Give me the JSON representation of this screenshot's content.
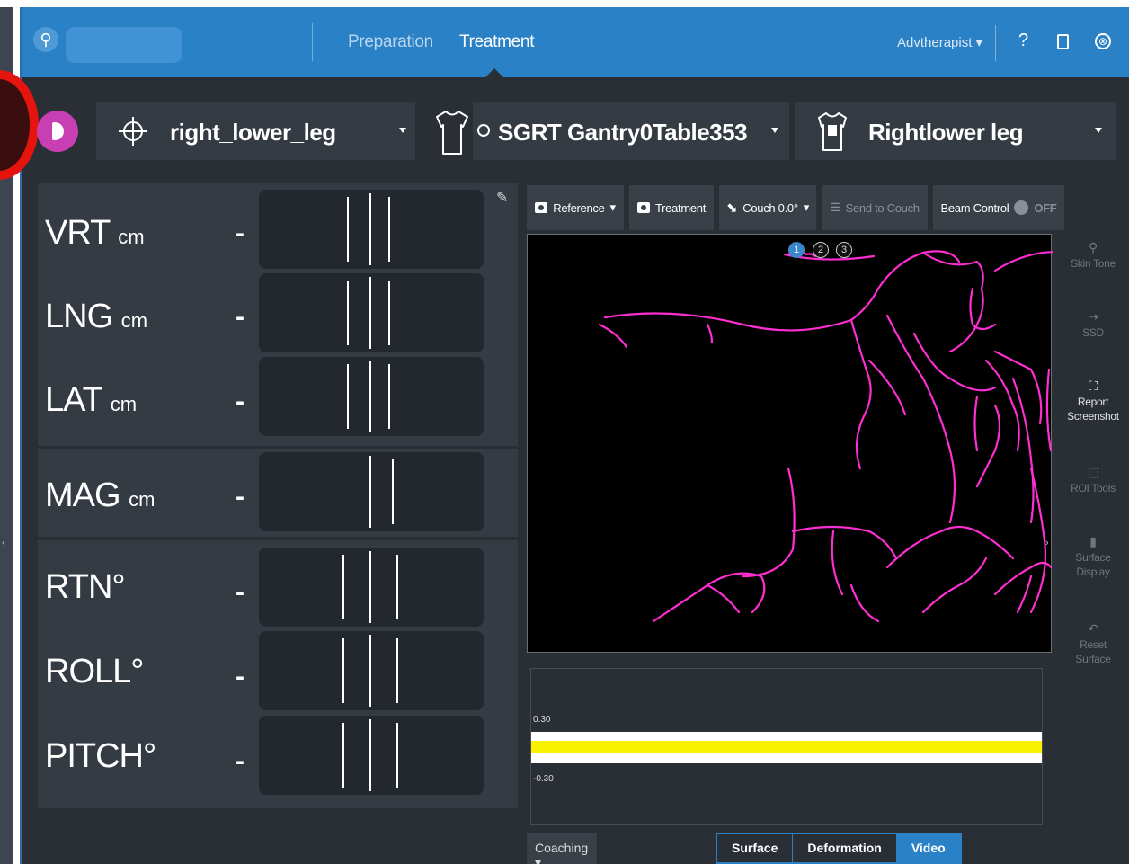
{
  "header": {
    "tabs": [
      "Preparation",
      "Treatment"
    ],
    "active_tab": "Treatment",
    "user_role": "Advtherapist",
    "help_label": "?",
    "close_glyph": "⊗"
  },
  "selectors": {
    "isocenter": "right_lower_leg",
    "plan": "SGRT Gantry0Table353",
    "roi": "Rightlower leg"
  },
  "table": {
    "rows": [
      {
        "label": "VRT",
        "unit": "cm",
        "value": "-"
      },
      {
        "label": "LNG",
        "unit": "cm",
        "value": "-"
      },
      {
        "label": "LAT",
        "unit": "cm",
        "value": "-"
      },
      {
        "label": "MAG",
        "unit": "cm",
        "value": "-"
      },
      {
        "label": "RTN",
        "unit": "°",
        "value": "-"
      },
      {
        "label": "ROLL",
        "unit": "°",
        "value": "-"
      },
      {
        "label": "PITCH",
        "unit": "°",
        "value": "-"
      }
    ]
  },
  "toolbar": {
    "reference": "Reference",
    "treatment": "Treatment",
    "couch": "Couch 0.0°",
    "send_to_couch": "Send to Couch",
    "beam_control": "Beam Control",
    "beam_state": "OFF"
  },
  "cameras": [
    "1",
    "2",
    "3"
  ],
  "side_tools": [
    {
      "label": "Skin Tone",
      "icon": "person-icon",
      "enabled": false
    },
    {
      "label": "SSD",
      "icon": "ruler-icon",
      "enabled": false
    },
    {
      "label": "Report Screenshot",
      "icon": "screenshot-icon",
      "enabled": true
    },
    {
      "label": "ROI Tools",
      "icon": "roi-icon",
      "enabled": false
    },
    {
      "label": "Surface Display",
      "icon": "surface-icon",
      "enabled": false
    },
    {
      "label": "Reset Surface",
      "icon": "reset-icon",
      "enabled": false
    }
  ],
  "chart": {
    "ytick_top": "0.30",
    "ytick_bottom": "-0.30"
  },
  "bottom": {
    "coaching": "Coaching",
    "view_modes": [
      "Surface",
      "Deformation",
      "Video"
    ],
    "active_view": "Video"
  },
  "colors": {
    "header_blue": "#2a81c5",
    "play_magenta": "#c73fb3",
    "contour_magenta": "#ff2ed1",
    "annotation_red": "#e6140f",
    "band_yellow": "#f8f100"
  }
}
